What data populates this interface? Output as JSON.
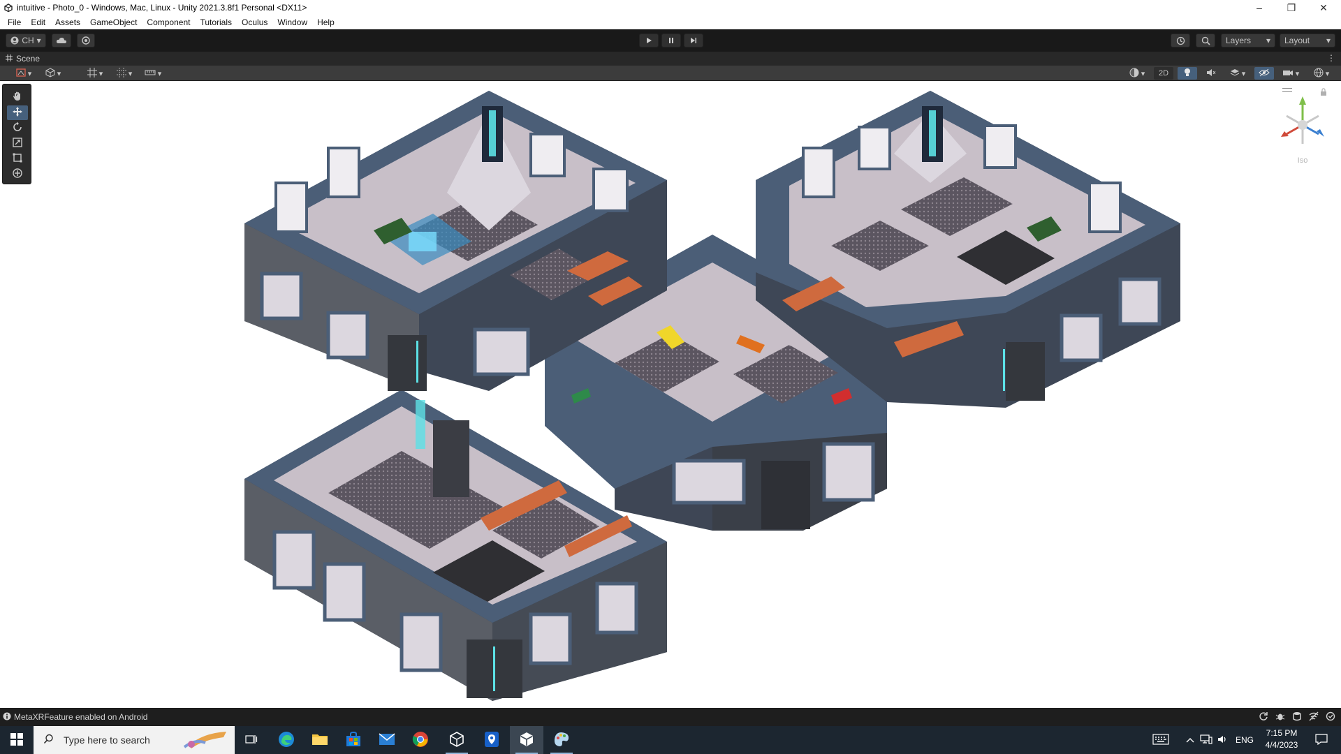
{
  "window": {
    "title": "intuitive - Photo_0 - Windows, Mac, Linux - Unity 2021.3.8f1 Personal <DX11>",
    "controls": [
      "–",
      "❐",
      "✕"
    ]
  },
  "menu": [
    "File",
    "Edit",
    "Assets",
    "GameObject",
    "Component",
    "Tutorials",
    "Oculus",
    "Window",
    "Help"
  ],
  "toolbar": {
    "account_label": "CH",
    "layers_label": "Layers",
    "layout_label": "Layout"
  },
  "scene_tab": {
    "label": "Scene"
  },
  "scene_toolbar": {
    "two_d_label": "2D"
  },
  "gizmo": {
    "projection_label": "Iso"
  },
  "status": {
    "message": "MetaXRFeature enabled on Android"
  },
  "taskbar": {
    "search_placeholder": "Type here to search",
    "language": "ENG",
    "time": "7:15 PM",
    "date": "4/4/2023"
  },
  "colors": {
    "accent": "#46607c",
    "editor_dark": "#191919",
    "wall": "#4a5d75",
    "floor": "#c9c0c8",
    "sofa": "#d2693a"
  }
}
